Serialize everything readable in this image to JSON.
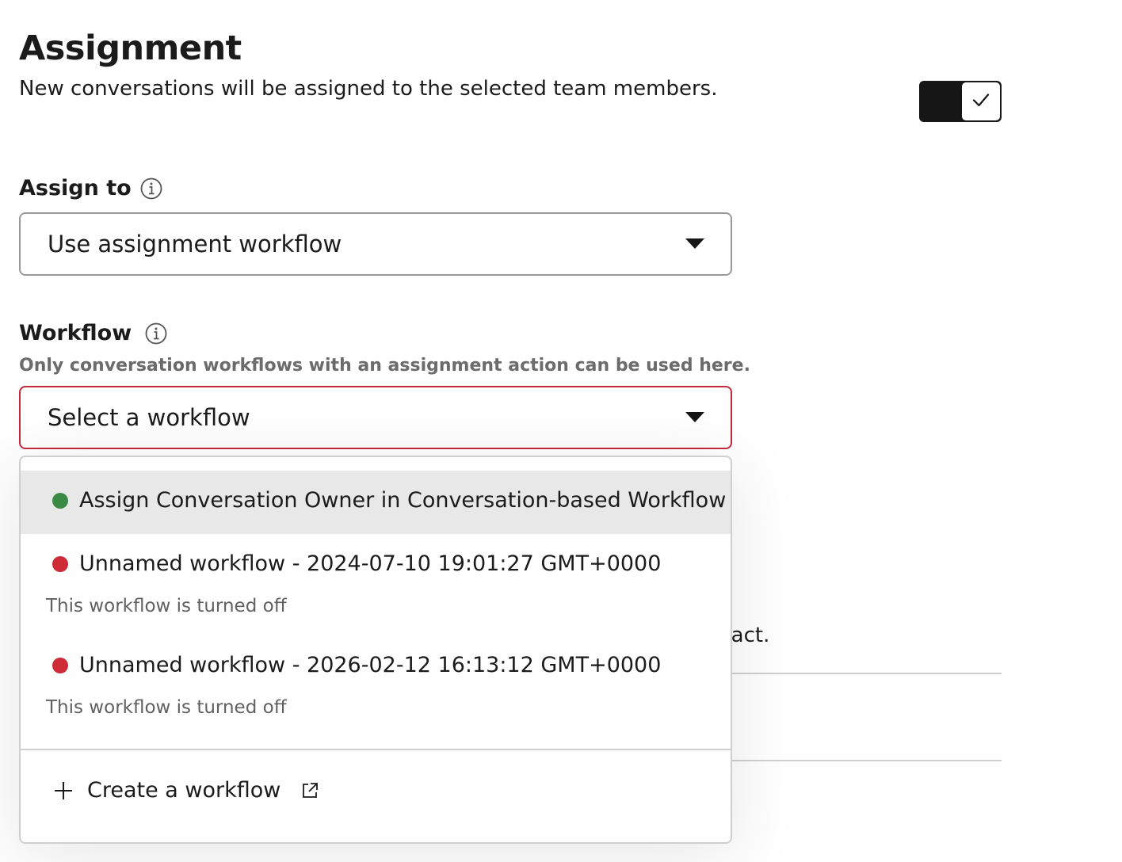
{
  "header": {
    "title": "Assignment",
    "description": "New conversations will be assigned to the selected team members."
  },
  "toggle": {
    "state": "on",
    "icon": "check-icon"
  },
  "assign_to": {
    "label": "Assign to",
    "info_icon": "info-icon",
    "selected": "Use assignment workflow"
  },
  "workflow": {
    "label": "Workflow",
    "info_icon": "info-icon",
    "hint": "Only conversation workflows with an assignment action can be used here.",
    "placeholder": "Select a workflow",
    "options": [
      {
        "name": "Assign Conversation Owner in Conversation-based Workflow",
        "status_color": "#3a8a44",
        "status_text": ""
      },
      {
        "name": "Unnamed workflow - 2024-07-10 19:01:27 GMT+0000",
        "status_color": "#cc2b37",
        "status_text": "This workflow is turned off"
      },
      {
        "name": "Unnamed workflow - 2026-02-12 16:13:12 GMT+0000",
        "status_color": "#cc2b37",
        "status_text": "This workflow is turned off"
      }
    ],
    "create_label": "Create a workflow"
  },
  "background": {
    "partial_text": "ntact."
  },
  "colors": {
    "error_border": "#c5293a",
    "toggle_on": "#161616"
  }
}
